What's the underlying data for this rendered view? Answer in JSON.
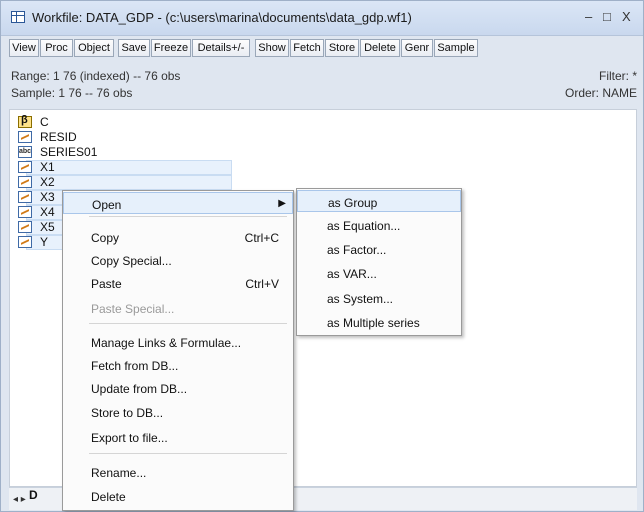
{
  "window": {
    "title": "Workfile: DATA_GDP - (c:\\users\\marina\\documents\\data_gdp.wf1)",
    "controls": [
      "–",
      "□",
      "X"
    ]
  },
  "toolbar": {
    "buttons": [
      "View",
      "Proc",
      "Object",
      "Save",
      "Freeze",
      "Details+/-",
      "Show",
      "Fetch",
      "Store",
      "Delete",
      "Genr",
      "Sample"
    ]
  },
  "info": {
    "range": "Range:  1 76 (indexed)  --  76 obs",
    "sample": "Sample: 1 76  --  76 obs",
    "filter": "Filter: *",
    "order": "Order: NAME"
  },
  "objects": [
    {
      "icon": "coef-icon",
      "label": "C"
    },
    {
      "icon": "series-icon",
      "label": "RESID"
    },
    {
      "icon": "alpha-icon",
      "label": "SERIES01"
    },
    {
      "icon": "series-icon",
      "label": "X1"
    },
    {
      "icon": "series-icon",
      "label": "X2"
    },
    {
      "icon": "series-icon",
      "label": "X3"
    },
    {
      "icon": "series-icon",
      "label": "X4"
    },
    {
      "icon": "series-icon",
      "label": "X5"
    },
    {
      "icon": "series-icon",
      "label": "Y"
    }
  ],
  "bottom": {
    "tab_label": "D"
  },
  "context_menu": {
    "items": [
      {
        "label": "Open",
        "shortcut": "",
        "submenu": true,
        "disabled": false
      },
      {
        "label": "Copy",
        "shortcut": "Ctrl+C",
        "submenu": false,
        "disabled": false
      },
      {
        "label": "Copy Special...",
        "shortcut": "",
        "submenu": false,
        "disabled": false
      },
      {
        "label": "Paste",
        "shortcut": "Ctrl+V",
        "submenu": false,
        "disabled": false
      },
      {
        "label": "Paste Special...",
        "shortcut": "",
        "submenu": false,
        "disabled": true
      },
      {
        "label": "Manage Links & Formulae...",
        "shortcut": "",
        "submenu": false,
        "disabled": false
      },
      {
        "label": "Fetch from DB...",
        "shortcut": "",
        "submenu": false,
        "disabled": false
      },
      {
        "label": "Update from DB...",
        "shortcut": "",
        "submenu": false,
        "disabled": false
      },
      {
        "label": "Store to DB...",
        "shortcut": "",
        "submenu": false,
        "disabled": false
      },
      {
        "label": "Export to file...",
        "shortcut": "",
        "submenu": false,
        "disabled": false
      },
      {
        "label": "Rename...",
        "shortcut": "",
        "submenu": false,
        "disabled": false
      },
      {
        "label": "Delete",
        "shortcut": "",
        "submenu": false,
        "disabled": false
      }
    ]
  },
  "submenu": {
    "items": [
      "as Group",
      "as Equation...",
      "as Factor...",
      "as VAR...",
      "as System...",
      "as Multiple series"
    ]
  },
  "colors": {
    "titlebar": "#c9d8ee",
    "highlight": "#e6f0fb",
    "highlight_border": "#a9c6ea"
  }
}
